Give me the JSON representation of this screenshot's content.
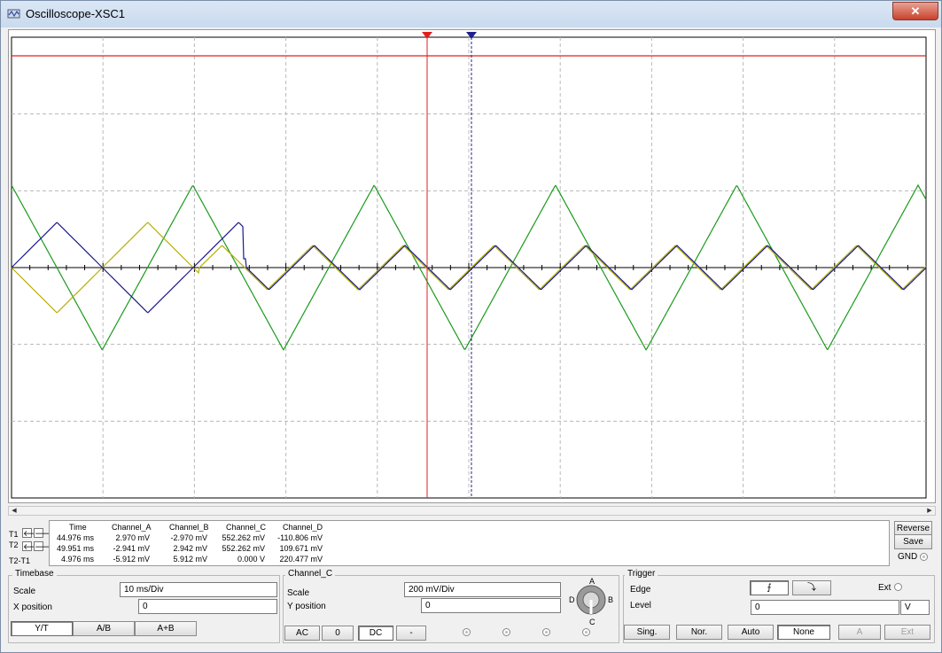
{
  "window": {
    "title": "Oscilloscope-XSC1",
    "close_glyph": "✕"
  },
  "plot": {
    "background": "#ffffff",
    "grid_color": "#b8b8b8",
    "axis_color": "#000000",
    "cursor1_color": "#e02020",
    "cursor2_color": "#20208c",
    "cursor1_marker": "1",
    "cursor2_marker": "2",
    "channel_colors": {
      "A": "#b8b000",
      "B": "#1a1a8c",
      "C": "#1a9a1a",
      "D": "#e02020"
    }
  },
  "readout": {
    "headers": [
      "Time",
      "Channel_A",
      "Channel_B",
      "Channel_C",
      "Channel_D"
    ],
    "rows": [
      {
        "label": "T1",
        "time": "44.976 ms",
        "a": "2.970 mV",
        "b": "-2.970 mV",
        "c": "552.262 mV",
        "d": "-110.806 mV"
      },
      {
        "label": "T2",
        "time": "49.951 ms",
        "a": "-2.941 mV",
        "b": "2.942 mV",
        "c": "552.262 mV",
        "d": "109.671 mV"
      },
      {
        "label": "T2-T1",
        "time": "4.976 ms",
        "a": "-5.912 mV",
        "b": "5.912 mV",
        "c": "0.000 V",
        "d": "220.477 mV"
      }
    ],
    "reverse": "Reverse",
    "save": "Save",
    "gnd": "GND"
  },
  "timebase": {
    "title": "Timebase",
    "scale_label": "Scale",
    "scale_value": "10 ms/Div",
    "xpos_label": "X position",
    "xpos_value": "0",
    "buttons": [
      "Y/T",
      "A/B",
      "A+B"
    ]
  },
  "channel": {
    "title": "Channel_C",
    "scale_label": "Scale",
    "scale_value": "200 mV/Div",
    "ypos_label": "Y position",
    "ypos_value": "0",
    "buttons": [
      "AC",
      "0",
      "DC",
      "-"
    ],
    "knob_labels": {
      "a": "A",
      "b": "B",
      "c": "C",
      "d": "D"
    }
  },
  "trigger": {
    "title": "Trigger",
    "edge_label": "Edge",
    "level_label": "Level",
    "level_value": "0",
    "level_unit": "V",
    "ext_label": "Ext",
    "rise_glyph": "⨍",
    "fall_glyph": "⤵",
    "buttons": [
      "Sing.",
      "Nor.",
      "Auto",
      "None"
    ],
    "src_buttons": [
      "A",
      "Ext"
    ]
  }
}
